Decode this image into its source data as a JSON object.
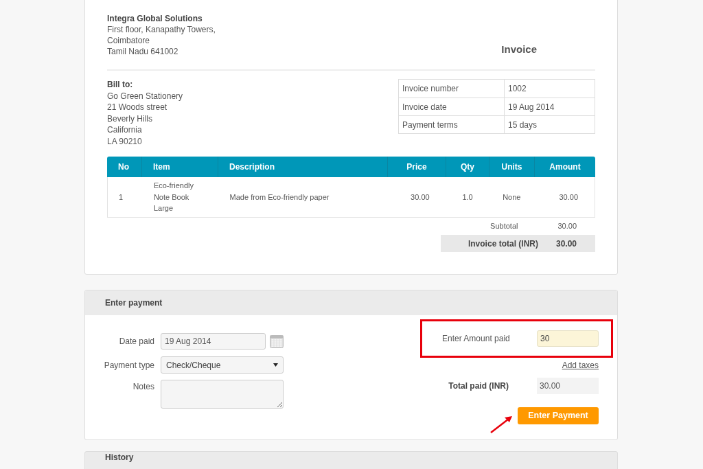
{
  "company": {
    "name": "Integra Global Solutions",
    "address": [
      "First floor, Kanapathy Towers,",
      "Coimbatore",
      "Tamil Nadu 641002"
    ]
  },
  "title": "Invoice",
  "bill_to": {
    "label": "Bill to:",
    "lines": [
      "Go Green Stationery",
      "21 Woods street",
      "Beverly Hills",
      "California",
      "LA 90210"
    ]
  },
  "details": [
    {
      "label": "Invoice number",
      "value": "1002"
    },
    {
      "label": "Invoice date",
      "value": "19 Aug 2014"
    },
    {
      "label": "Payment terms",
      "value": "15 days"
    }
  ],
  "items_table": {
    "columns": [
      "No",
      "Item",
      "Description",
      "Price",
      "Qty",
      "Units",
      "Amount"
    ],
    "rows": [
      [
        "1",
        "Eco-friendly Note Book Large",
        "Made from Eco-friendly paper",
        "30.00",
        "1.0",
        "None",
        "30.00"
      ]
    ]
  },
  "subtotal": {
    "label": "Subtotal",
    "value": "30.00"
  },
  "total": {
    "label": "Invoice total (INR)",
    "value": "30.00"
  },
  "payment": {
    "title": "Enter payment",
    "date_paid": {
      "label": "Date paid",
      "value": "19 Aug 2014"
    },
    "payment_type": {
      "label": "Payment type",
      "value": "Check/Cheque"
    },
    "notes": {
      "label": "Notes"
    },
    "amount_paid": {
      "label": "Enter Amount paid",
      "value": "30"
    },
    "add_taxes": "Add taxes",
    "total_paid": {
      "label": "Total paid (INR)",
      "value": "30.00"
    },
    "button": "Enter Payment"
  },
  "history": {
    "title": "History"
  }
}
